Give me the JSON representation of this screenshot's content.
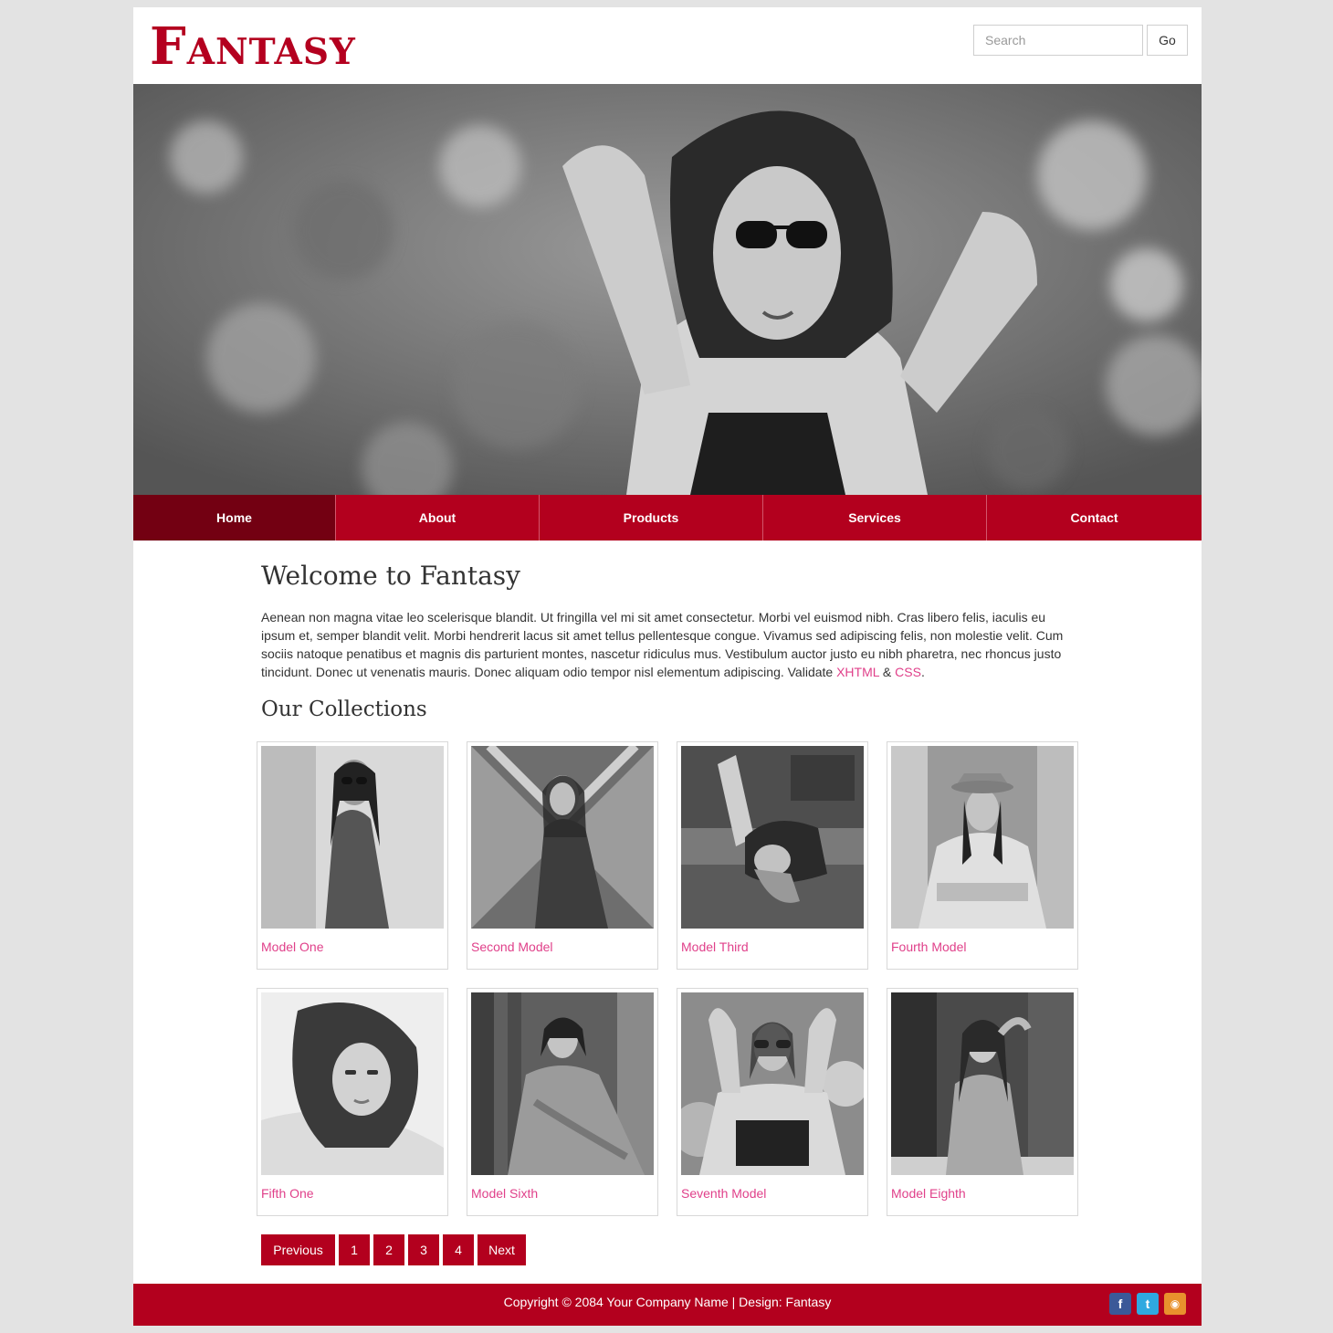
{
  "header": {
    "logo_text": "Fantasy",
    "search_placeholder": "Search",
    "go_label": "Go"
  },
  "nav": {
    "items": [
      {
        "label": "Home",
        "active": true
      },
      {
        "label": "About"
      },
      {
        "label": "Products"
      },
      {
        "label": "Services"
      },
      {
        "label": "Contact"
      }
    ]
  },
  "main": {
    "welcome_title": "Welcome to Fantasy",
    "intro_text": "Aenean non magna vitae leo scelerisque blandit. Ut fringilla vel mi sit amet consectetur. Morbi vel euismod nibh. Cras libero felis, iaculis eu ipsum et, semper blandit velit. Morbi hendrerit lacus sit amet tellus pellentesque congue. Vivamus sed adipiscing felis, non molestie velit. Cum sociis natoque penatibus et magnis dis parturient montes, nascetur ridiculus mus. Vestibulum auctor justo eu nibh pharetra, nec rhoncus justo tincidunt. Donec ut venenatis mauris. Donec aliquam odio tempor nisl elementum adipiscing. Validate ",
    "xhtml_link": "XHTML",
    "amp": " & ",
    "css_link": "CSS",
    "period": ".",
    "collections_title": "Our Collections"
  },
  "gallery": {
    "items": [
      {
        "caption": "Model One"
      },
      {
        "caption": "Second Model"
      },
      {
        "caption": "Model Third"
      },
      {
        "caption": "Fourth Model"
      },
      {
        "caption": "Fifth One"
      },
      {
        "caption": "Model Sixth"
      },
      {
        "caption": "Seventh Model"
      },
      {
        "caption": "Model Eighth"
      }
    ]
  },
  "pagination": {
    "previous": "Previous",
    "pages": [
      "1",
      "2",
      "3",
      "4"
    ],
    "next": "Next"
  },
  "footer": {
    "copyright": "Copyright © 2084 Your Company Name | Design: Fantasy",
    "social": [
      {
        "icon": "facebook-icon",
        "glyph": "f",
        "color": "#3b5998"
      },
      {
        "icon": "twitter-icon",
        "glyph": "t",
        "color": "#2fa9e0"
      },
      {
        "icon": "rss-icon",
        "glyph": "◉",
        "color": "#e8912d"
      }
    ]
  },
  "colors": {
    "brand": "#b3001e",
    "nav_active": "#730012",
    "link": "#e0408a",
    "page_bg": "#e3e3e3"
  }
}
